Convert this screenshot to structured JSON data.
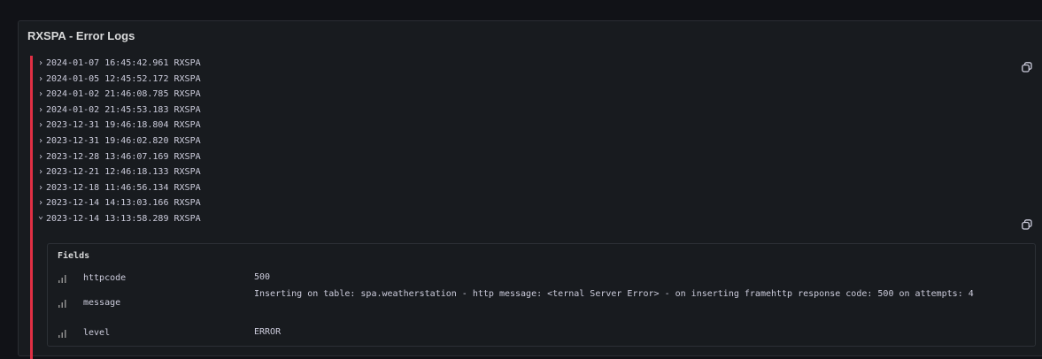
{
  "panel": {
    "title": "RXSPA - Error Logs"
  },
  "logs": [
    {
      "timestamp": "2024-01-07 16:45:42.961",
      "label": "RXSPA",
      "expanded": false
    },
    {
      "timestamp": "2024-01-05 12:45:52.172",
      "label": "RXSPA",
      "expanded": false
    },
    {
      "timestamp": "2024-01-02 21:46:08.785",
      "label": "RXSPA",
      "expanded": false
    },
    {
      "timestamp": "2024-01-02 21:45:53.183",
      "label": "RXSPA",
      "expanded": false
    },
    {
      "timestamp": "2023-12-31 19:46:18.804",
      "label": "RXSPA",
      "expanded": false
    },
    {
      "timestamp": "2023-12-31 19:46:02.820",
      "label": "RXSPA",
      "expanded": false
    },
    {
      "timestamp": "2023-12-28 13:46:07.169",
      "label": "RXSPA",
      "expanded": false
    },
    {
      "timestamp": "2023-12-21 12:46:18.133",
      "label": "RXSPA",
      "expanded": false
    },
    {
      "timestamp": "2023-12-18 11:46:56.134",
      "label": "RXSPA",
      "expanded": false
    },
    {
      "timestamp": "2023-12-14 14:13:03.166",
      "label": "RXSPA",
      "expanded": false
    },
    {
      "timestamp": "2023-12-14 13:13:58.289",
      "label": "RXSPA",
      "expanded": true
    }
  ],
  "details": {
    "title": "Fields",
    "fields": [
      {
        "name": "httpcode",
        "value": "500"
      },
      {
        "name": "message",
        "value": "Inserting on table: spa.weatherstation - http message: <ternal Server Error> - on inserting framehttp response code: 500 on attempts: 4"
      },
      {
        "name": "level",
        "value": "ERROR"
      }
    ]
  },
  "colors": {
    "level_error": "#e02f44",
    "panel_bg": "#181b1f",
    "text": "#ccccdc"
  },
  "icons": {
    "copy": "copy-icon",
    "field_stats": "bar-chart-icon",
    "collapsed": "chevron-right-icon",
    "expanded": "chevron-down-icon"
  }
}
